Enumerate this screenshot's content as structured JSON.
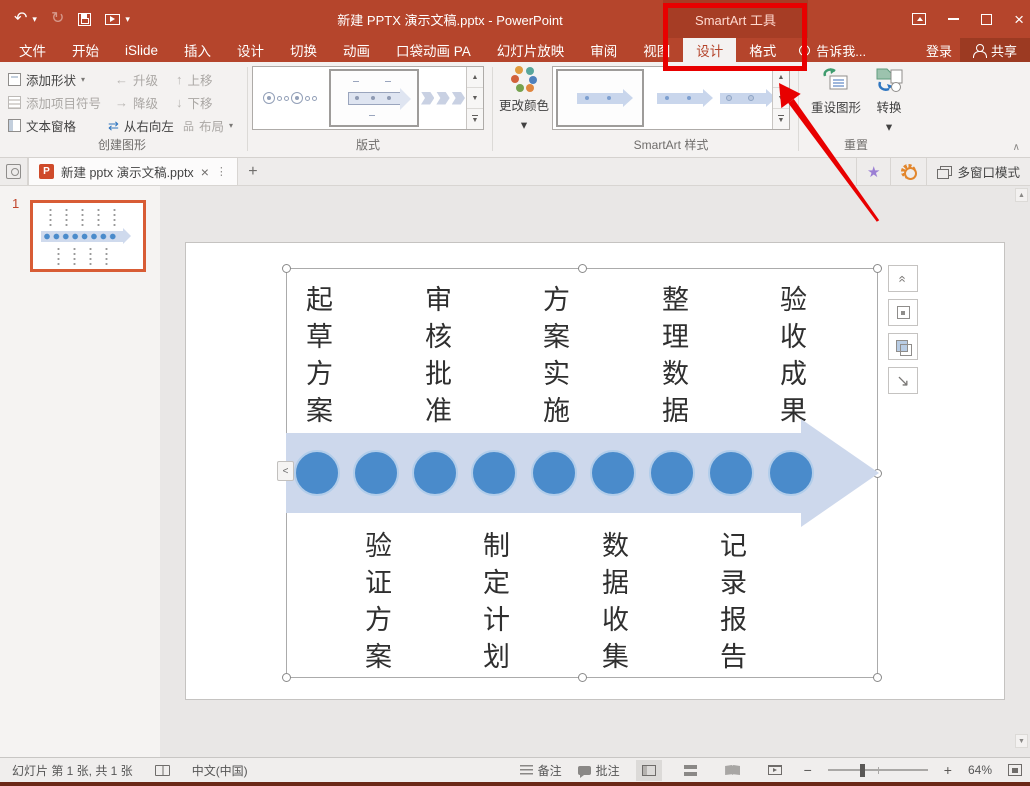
{
  "titlebar": {
    "title": "新建 PPTX 演示文稿.pptx - PowerPoint",
    "contextual_tool": "SmartArt 工具"
  },
  "tabs": [
    {
      "label": "文件"
    },
    {
      "label": "开始"
    },
    {
      "label": "iSlide"
    },
    {
      "label": "插入"
    },
    {
      "label": "设计"
    },
    {
      "label": "切换"
    },
    {
      "label": "动画"
    },
    {
      "label": "口袋动画 PA"
    },
    {
      "label": "幻灯片放映"
    },
    {
      "label": "审阅"
    },
    {
      "label": "视图"
    }
  ],
  "contextual_tabs": [
    {
      "label": "设计"
    },
    {
      "label": "格式"
    }
  ],
  "tell_me": "告诉我...",
  "account": {
    "sign_in": "登录",
    "share": "共享"
  },
  "ribbon": {
    "create_graphic": {
      "add_shape": "添加形状",
      "add_bullet": "添加项目符号",
      "text_pane": "文本窗格",
      "promote": "升级",
      "demote": "降级",
      "right_to_left": "从右向左",
      "move_up": "上移",
      "move_down": "下移",
      "layout": "布局",
      "group_label": "创建图形"
    },
    "layouts": {
      "group_label": "版式"
    },
    "styles": {
      "change_colors": "更改颜色",
      "group_label": "SmartArt 样式"
    },
    "reset": {
      "reset_graphic": "重设图形",
      "convert": "转换",
      "group_label": "重置"
    }
  },
  "doctab_bar": {
    "active_tab": "新建 pptx 演示文稿.pptx",
    "multi_window": "多窗口模式"
  },
  "slides_panel": {
    "slide_number": "1"
  },
  "slide": {
    "smartart": {
      "top_labels": [
        "起草方案",
        "审核批准",
        "方案实施",
        "整理数据",
        "验收成果"
      ],
      "bottom_labels": [
        "验证方案",
        "制定计划",
        "数据收集",
        "记录报告"
      ],
      "circle_count": 9
    }
  },
  "statusbar": {
    "slide_info": "幻灯片 第 1 张, 共 1 张",
    "language": "中文(中国)",
    "notes": "备注",
    "comments": "批注",
    "zoom_level": "64%"
  },
  "glyphs": {
    "undo": "↶",
    "redo": "↻",
    "dropdown": "▾",
    "close": "×",
    "tab_menu": "⋮",
    "new_tab": "+",
    "promote_arrow": "←",
    "demote_arrow": "→",
    "up_arrow": "↑",
    "down_arrow": "↓",
    "rtl_arrows": "⇄",
    "layout_icon": "品",
    "gallery_up": "▲",
    "gallery_down": "▼",
    "ribbon_collapse": "∧",
    "textpane_toggle": "<",
    "chevrons_up": "«",
    "diag_arrow": "↘",
    "zoom_out": "−",
    "zoom_in": "+",
    "wand": "★",
    "ppt_logo": "P"
  },
  "colors": {
    "accent_red": "#b5452c",
    "contextual_red": "#a63d25",
    "annotation_red": "#e80000",
    "smartart_circle_blue": "#4a8bcb",
    "smartart_arrow_blue": "#cdd8ec",
    "thumbnail_border_orange": "#d85c35"
  }
}
